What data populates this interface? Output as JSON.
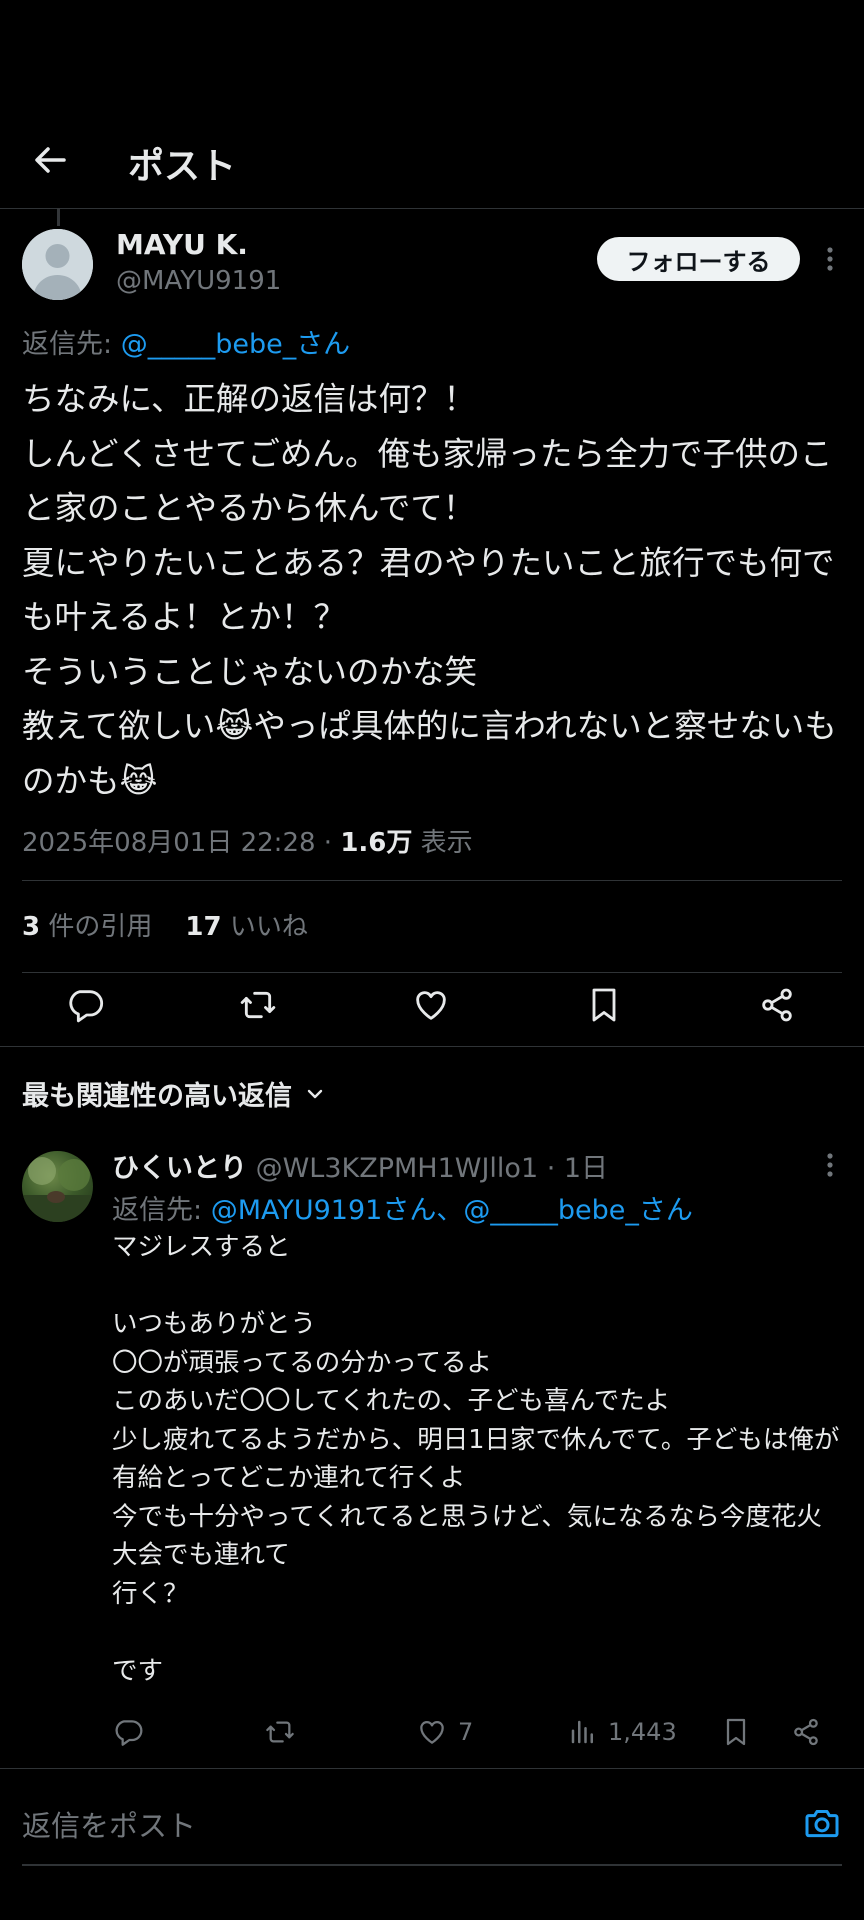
{
  "header": {
    "title": "ポスト"
  },
  "post": {
    "author_name": "MAYU K.",
    "author_handle": "@MAYU9191",
    "follow_label": "フォローする",
    "reply_prefix": "返信先: ",
    "reply_mention": "@_____bebe_さん",
    "body": "ちなみに、正解の返信は何？！\nしんどくさせてごめん。俺も家帰ったら全力で子供のこと家のことやるから休んでて！\n夏にやりたいことある？君のやりたいこと旅行でも何でも叶えるよ！とか！？\nそういうことじゃないのかな笑\n教えて欲しい😹やっぱ具体的に言われないと察せないものかも😹",
    "timestamp": "2025年08月01日 22:28",
    "meta_sep": " · ",
    "views_count": "1.6万",
    "views_label": " 表示",
    "quotes_count": "3",
    "quotes_label": " 件の引用",
    "likes_count": "17",
    "likes_label": " いいね"
  },
  "replies_section": {
    "sort_label": "最も関連性の高い返信"
  },
  "reply": {
    "name": "ひくいとり",
    "handle_time": " @WL3KZPMH1WJllo1 · 1日",
    "reply_prefix": "返信先: ",
    "reply_mentions": "@MAYU9191さん、@_____bebe_さん",
    "body": "マジレスすると\n\nいつもありがとう\n〇〇が頑張ってるの分かってるよ\nこのあいだ〇〇してくれたの、子ども喜んでたよ\n少し疲れてるようだから、明日1日家で休んでて。子どもは俺が有給とってどこか連れて行くよ\n今でも十分やってくれてると思うけど、気になるなら今度花火大会でも連れて\n行く？\n\nです",
    "likes": "7",
    "views": "1,443"
  },
  "compose": {
    "placeholder": "返信をポスト"
  },
  "colors": {
    "accent": "#1d9bf0",
    "muted": "#71767b",
    "text": "#e7e9ea",
    "divider": "#2f3336"
  },
  "icons": [
    "back-arrow-icon",
    "more-vertical-icon",
    "reply-icon",
    "retweet-icon",
    "like-icon",
    "bookmark-icon",
    "share-icon",
    "chevron-down-icon",
    "views-icon",
    "camera-icon",
    "default-avatar-icon"
  ]
}
